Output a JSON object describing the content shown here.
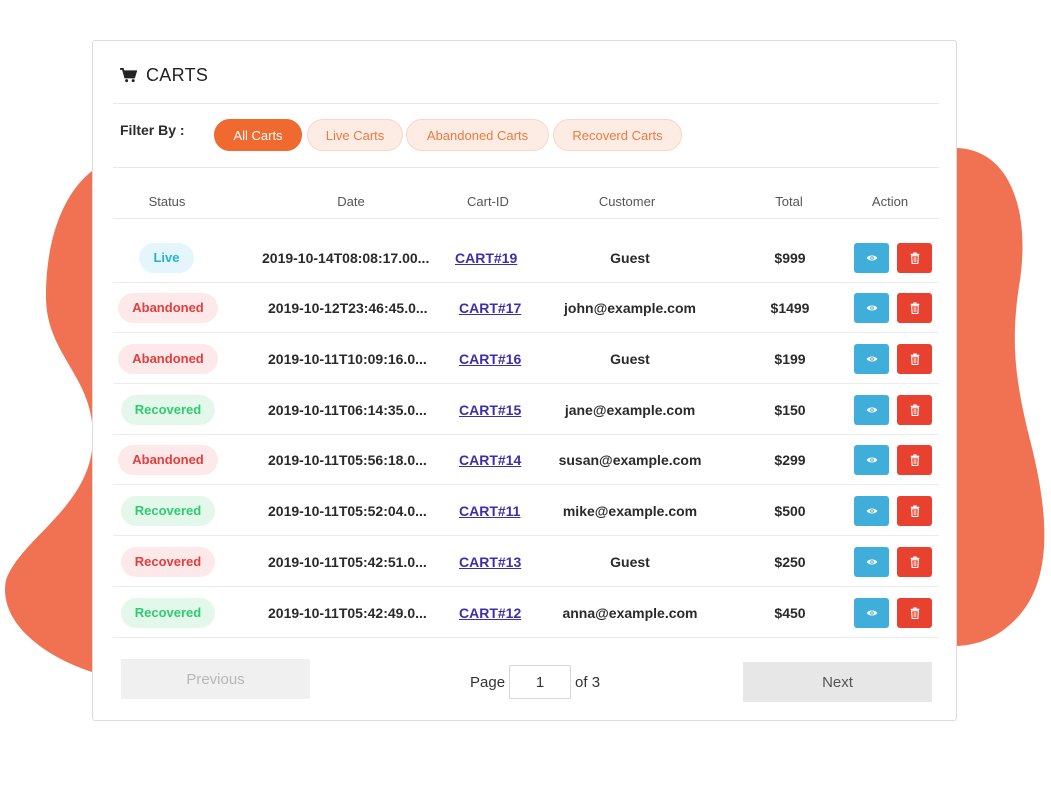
{
  "header": {
    "title": "CARTS",
    "icon": "shopping-cart-icon"
  },
  "filter": {
    "label": "Filter By :",
    "options": [
      {
        "label": "All Carts",
        "active": true
      },
      {
        "label": "Live Carts",
        "active": false
      },
      {
        "label": "Abandoned Carts",
        "active": false
      },
      {
        "label": "Recoverd Carts",
        "active": false
      }
    ]
  },
  "table": {
    "columns": [
      "Status",
      "Date",
      "Cart-ID",
      "Customer",
      "Total",
      "Action"
    ],
    "rows": [
      {
        "status": "Live",
        "status_type": "live",
        "date": "2019-10-14T08:08:17.00...",
        "cart_id": "CART#19",
        "customer": "Guest",
        "total": "$999"
      },
      {
        "status": "Abandoned",
        "status_type": "abandoned",
        "date": "2019-10-12T23:46:45.0...",
        "cart_id": "CART#17",
        "customer": "john@example.com",
        "total": "$1499"
      },
      {
        "status": "Abandoned",
        "status_type": "abandoned",
        "date": "2019-10-11T10:09:16.0...",
        "cart_id": "CART#16",
        "customer": "Guest",
        "total": "$199"
      },
      {
        "status": "Recovered",
        "status_type": "recovered",
        "date": "2019-10-11T06:14:35.0...",
        "cart_id": "CART#15",
        "customer": "jane@example.com",
        "total": "$150"
      },
      {
        "status": "Abandoned",
        "status_type": "abandoned",
        "date": "2019-10-11T05:56:18.0...",
        "cart_id": "CART#14",
        "customer": "susan@example.com",
        "total": "$299"
      },
      {
        "status": "Recovered",
        "status_type": "recovered",
        "date": "2019-10-11T05:52:04.0...",
        "cart_id": "CART#11",
        "customer": "mike@example.com",
        "total": "$500"
      },
      {
        "status": "Recovered",
        "status_type": "recovered-red",
        "date": "2019-10-11T05:42:51.0...",
        "cart_id": "CART#13",
        "customer": "Guest",
        "total": "$250"
      },
      {
        "status": "Recovered",
        "status_type": "recovered",
        "date": "2019-10-11T05:42:49.0...",
        "cart_id": "CART#12",
        "customer": "anna@example.com",
        "total": "$450"
      }
    ],
    "actions": {
      "view_icon": "eye-icon",
      "delete_icon": "trash-icon"
    }
  },
  "pagination": {
    "previous_label": "Previous",
    "next_label": "Next",
    "page_label": "Page",
    "current_page": "1",
    "of_label": "of 3"
  },
  "colors": {
    "accent": "#f0692e",
    "blob": "#f07253",
    "view_button": "#3faedb",
    "delete_button": "#e8412f",
    "link": "#3d2fa8"
  }
}
